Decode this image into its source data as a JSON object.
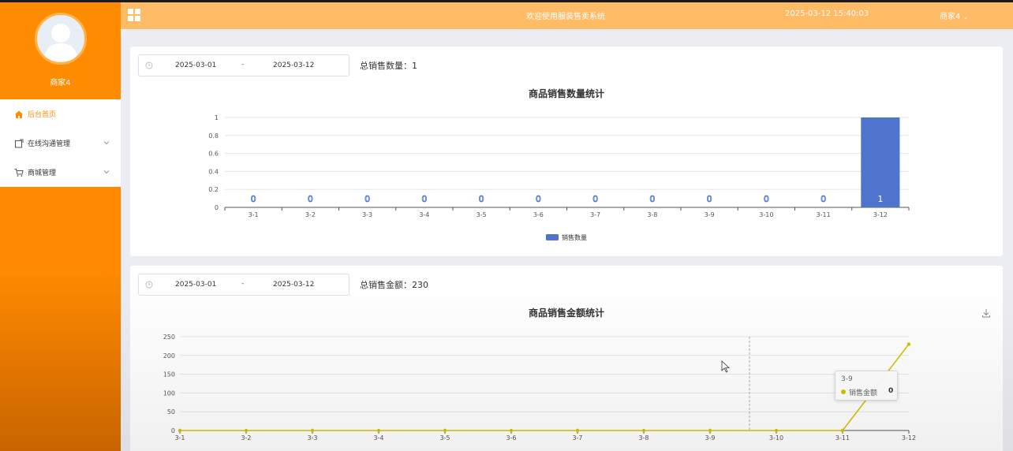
{
  "sidebar": {
    "username": "商家4",
    "items": [
      {
        "label": "后台首页",
        "icon": "home-icon",
        "active": true
      },
      {
        "label": "在线沟通管理",
        "icon": "chat-doc-icon",
        "active": false
      },
      {
        "label": "商城管理",
        "icon": "cart-icon",
        "active": false
      }
    ]
  },
  "header": {
    "welcome": "欢迎使用服装售卖系统",
    "datetime": "2025-03-12 15:40:03",
    "user_menu": "商家4"
  },
  "quantity_panel": {
    "start_date": "2025-03-01",
    "separator": "-",
    "end_date": "2025-03-12",
    "total_label": "总销售数量：1"
  },
  "amount_panel": {
    "start_date": "2025-03-01",
    "separator": "-",
    "end_date": "2025-03-12",
    "total_label": "总销售金额：230",
    "tooltip": {
      "title": "3-9",
      "series": "销售金额",
      "value": "0"
    }
  },
  "colors": {
    "brand": "#ff8c00",
    "header": "#ffbb66",
    "bar": "#4e74cd",
    "line": "#d4c300"
  },
  "chart_data": [
    {
      "type": "bar",
      "title": "商品销售数量统计",
      "categories": [
        "3-1",
        "3-2",
        "3-3",
        "3-4",
        "3-5",
        "3-6",
        "3-7",
        "3-8",
        "3-9",
        "3-10",
        "3-11",
        "3-12"
      ],
      "series": [
        {
          "name": "销售数量",
          "values": [
            0,
            0,
            0,
            0,
            0,
            0,
            0,
            0,
            0,
            0,
            0,
            1
          ]
        }
      ],
      "y_ticks": [
        "0",
        "0.2",
        "0.4",
        "0.6",
        "0.8",
        "1"
      ],
      "ylim": [
        0,
        1
      ],
      "grid": true,
      "legend": "bottom-center"
    },
    {
      "type": "line",
      "title": "商品销售金额统计",
      "categories": [
        "3-1",
        "3-2",
        "3-3",
        "3-4",
        "3-5",
        "3-6",
        "3-7",
        "3-8",
        "3-9",
        "3-10",
        "3-11",
        "3-12"
      ],
      "series": [
        {
          "name": "销售金额",
          "values": [
            0,
            0,
            0,
            0,
            0,
            0,
            0,
            0,
            0,
            0,
            0,
            230
          ]
        }
      ],
      "y_ticks": [
        "0",
        "50",
        "100",
        "150",
        "200",
        "250"
      ],
      "ylim": [
        0,
        250
      ],
      "grid": true,
      "legend": "none"
    }
  ]
}
